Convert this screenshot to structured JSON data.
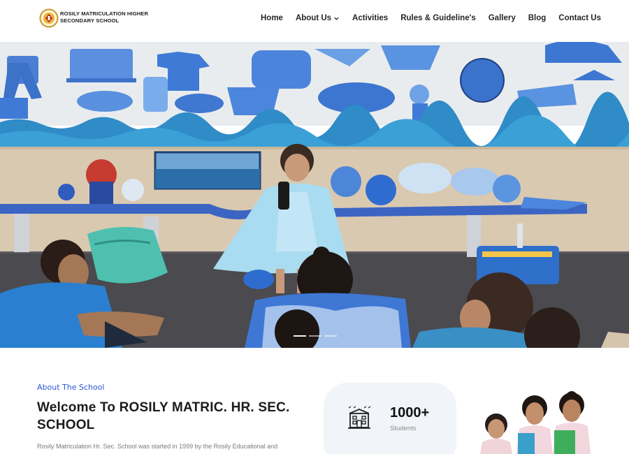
{
  "header": {
    "school_name": "ROSILY MATRICULATION HIGHER SECONDARY SCHOOL",
    "nav": [
      {
        "label": "Home"
      },
      {
        "label": "About Us",
        "has_dropdown": true
      },
      {
        "label": "Activities"
      },
      {
        "label": "Rules & Guideline's"
      },
      {
        "label": "Gallery"
      },
      {
        "label": "Blog"
      },
      {
        "label": "Contact Us"
      }
    ]
  },
  "hero": {
    "slides_count": 3,
    "active_slide": 1
  },
  "about": {
    "eyebrow": "About The School",
    "title": "Welcome To ROSILY MATRIC. HR. SEC. SCHOOL",
    "text": "Rosily Matriculation Hr. Sec. School was started in 1999 by the Rosily Educational and"
  },
  "stats": {
    "value": "1000+",
    "label": "Students",
    "icon": "school-building-icon"
  },
  "colors": {
    "accent": "#2a57d8",
    "stat_card_bg": "#f1f4f8"
  }
}
